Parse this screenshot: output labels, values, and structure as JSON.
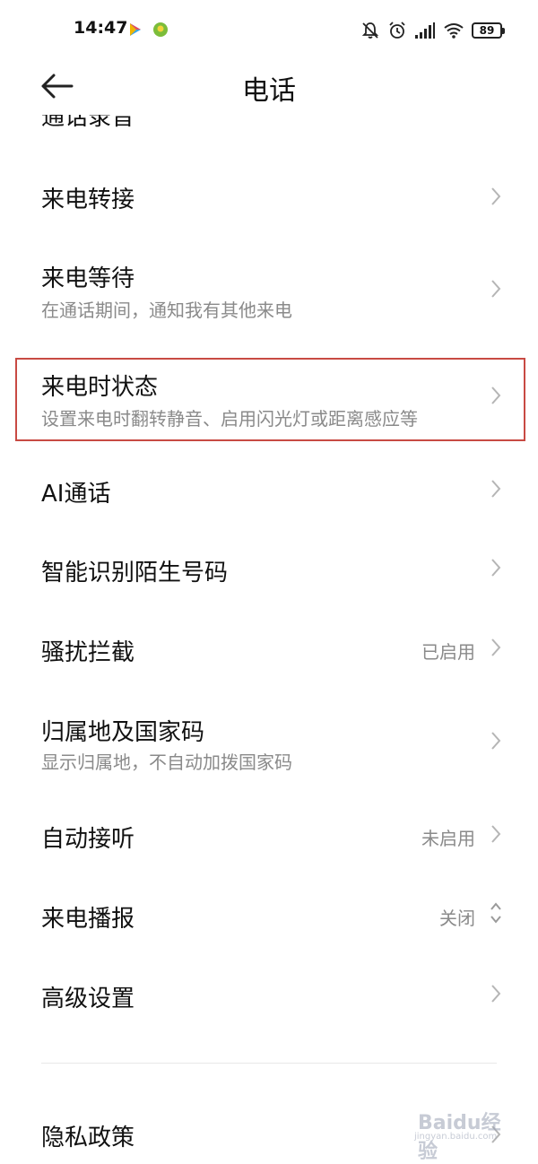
{
  "status_bar": {
    "time": "14:47",
    "battery": "89",
    "icons": [
      "play-store-icon",
      "app-badge-icon",
      "mute-bell-icon",
      "alarm-icon",
      "signal-icon",
      "wifi-icon",
      "battery-icon"
    ]
  },
  "header": {
    "title": "电话",
    "back_icon": "back-arrow-icon"
  },
  "settings": {
    "cut_off_item": "通话录音",
    "items": [
      {
        "label": "来电转接",
        "subtitle": "",
        "value": ""
      },
      {
        "label": "来电等待",
        "subtitle": "在通话期间，通知我有其他来电",
        "value": ""
      },
      {
        "label": "来电时状态",
        "subtitle": "设置来电时翻转静音、启用闪光灯或距离感应等",
        "value": ""
      },
      {
        "label": "AI通话",
        "subtitle": "",
        "value": ""
      },
      {
        "label": "智能识别陌生号码",
        "subtitle": "",
        "value": ""
      },
      {
        "label": "骚扰拦截",
        "subtitle": "",
        "value": "已启用"
      },
      {
        "label": "归属地及国家码",
        "subtitle": "显示归属地，不自动加拨国家码",
        "value": ""
      },
      {
        "label": "自动接听",
        "subtitle": "",
        "value": "未启用"
      },
      {
        "label": "来电播报",
        "subtitle": "",
        "value": "关闭"
      },
      {
        "label": "高级设置",
        "subtitle": "",
        "value": ""
      }
    ],
    "footer_item": {
      "label": "隐私政策"
    }
  },
  "watermark": {
    "brand": "Baidu经验",
    "url": "jingyan.baidu.com"
  },
  "colors": {
    "highlight_border": "#c84a43",
    "secondary_text": "#8a8a8a",
    "chevron": "#b5b5b5"
  }
}
